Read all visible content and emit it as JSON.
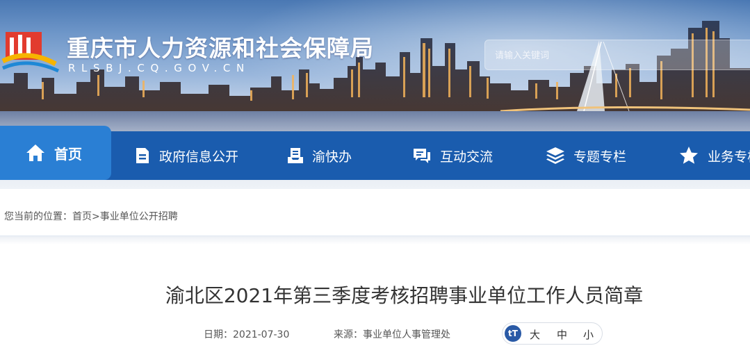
{
  "header": {
    "title": "重庆市人力资源和社会保障局",
    "domain": "RLSBJ.CQ.GOV.CN",
    "search_placeholder": "请输入关键词"
  },
  "nav": {
    "items": [
      {
        "label": "首页",
        "icon": "home-icon",
        "active": true
      },
      {
        "label": "政府信息公开",
        "icon": "document-icon"
      },
      {
        "label": "渝快办",
        "icon": "file-tray-icon"
      },
      {
        "label": "互动交流",
        "icon": "chat-icon"
      },
      {
        "label": "专题专栏",
        "icon": "layers-icon"
      },
      {
        "label": "业务专栏",
        "icon": "star-icon"
      }
    ]
  },
  "breadcrumb": {
    "prefix": "您当前的位置：",
    "home": "首页",
    "separator": ">",
    "current": "事业单位公开招聘"
  },
  "article": {
    "title": "渝北区2021年第三季度考核招聘事业单位工作人员简章",
    "date_label": "日期：",
    "date": "2021-07-30",
    "source_label": "来源：",
    "source": "事业单位人事管理处"
  },
  "font_size_control": {
    "icon": "tT",
    "large": "大",
    "medium": "中",
    "small": "小"
  },
  "colors": {
    "nav_bg": "#1a5cae",
    "nav_active": "#2a7fd4",
    "title_text": "#333333"
  }
}
